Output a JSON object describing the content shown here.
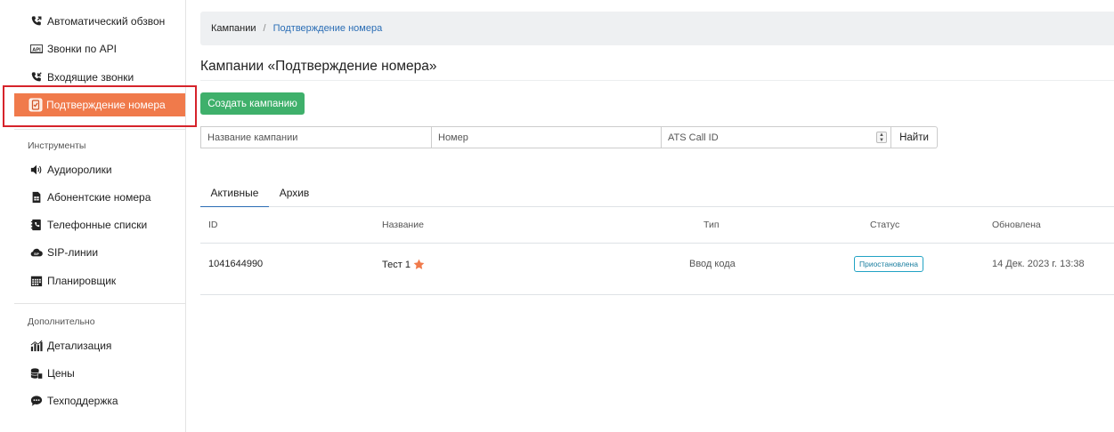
{
  "sidebar": {
    "items_top": [
      {
        "label": "Автоматический обзвон",
        "icon": "phone-icon"
      },
      {
        "label": "Звонки по API",
        "icon": "api-icon"
      },
      {
        "label": "Входящие звонки",
        "icon": "phone-icon"
      },
      {
        "label": "Подтверждение номера",
        "icon": "verify-icon",
        "active": true
      }
    ],
    "tools_title": "Инструменты",
    "items_tools": [
      {
        "label": "Аудиоролики",
        "icon": "speaker-icon"
      },
      {
        "label": "Абонентские номера",
        "icon": "sim-card-icon"
      },
      {
        "label": "Телефонные списки",
        "icon": "phone-book-icon"
      },
      {
        "label": "SIP-линии",
        "icon": "cloud-icon"
      },
      {
        "label": "Планировщик",
        "icon": "calendar-icon"
      }
    ],
    "extra_title": "Дополнительно",
    "items_extra": [
      {
        "label": "Детализация",
        "icon": "bar-chart-icon"
      },
      {
        "label": "Цены",
        "icon": "coins-icon"
      },
      {
        "label": "Техподдержка",
        "icon": "chat-icon"
      }
    ]
  },
  "breadcrumb": {
    "home": "Кампании",
    "separator": "/",
    "current": "Подтверждение номера"
  },
  "page_title": "Кампании «Подтверждение номера»",
  "create_button": "Создать кампанию",
  "filters": {
    "name_placeholder": "Название кампании",
    "number_placeholder": "Номер",
    "ats_placeholder": "ATS Call ID",
    "find_button": "Найти"
  },
  "tabs": [
    {
      "label": "Активные",
      "active": true
    },
    {
      "label": "Архив",
      "active": false
    }
  ],
  "table": {
    "headers": {
      "id": "ID",
      "name": "Название",
      "type": "Тип",
      "status": "Статус",
      "updated": "Обновлена"
    },
    "rows": [
      {
        "id": "1041644990",
        "name": "Тест 1",
        "starred": true,
        "type": "Ввод кода",
        "status": "Приостановлена",
        "updated": "14 Дек. 2023 г. 13:38"
      }
    ]
  },
  "colors": {
    "active_item": "#f07a4b",
    "highlight_outline": "#d6232b",
    "create_button": "#3fb06b",
    "link": "#2a6db5",
    "star": "#f07a4b",
    "status_badge": "#22a3c4"
  }
}
